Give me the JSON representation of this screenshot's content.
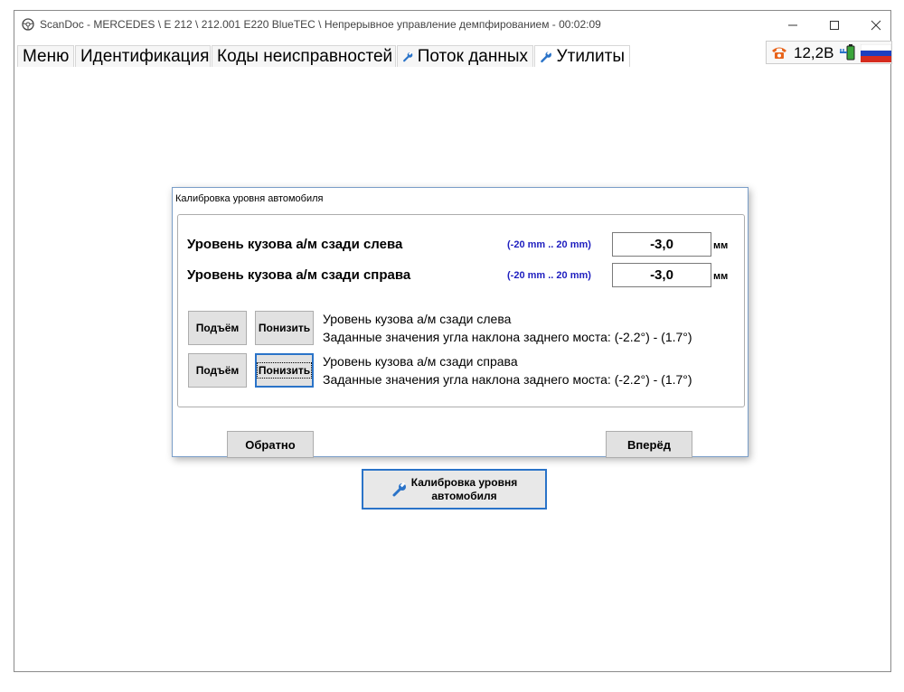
{
  "window": {
    "title": "ScanDoc - MERCEDES \\ E 212 \\ 212.001 E220 BlueTEC \\ Непрерывное управление демпфированием - 00:02:09"
  },
  "tabs": [
    {
      "label": "Меню",
      "icon": ""
    },
    {
      "label": "Идентификация",
      "icon": ""
    },
    {
      "label": "Коды неисправностей",
      "icon": ""
    },
    {
      "label": "Поток данных",
      "icon": "wrench-icon"
    },
    {
      "label": "Утилиты",
      "icon": "wrench-icon"
    }
  ],
  "status": {
    "voltage": "12,2В"
  },
  "dialog": {
    "title": "Калибровка уровня автомобиля",
    "params": [
      {
        "label": "Уровень кузова а/м сзади слева",
        "range": "(-20 mm .. 20 mm)",
        "value": "-3,0",
        "unit": "мм"
      },
      {
        "label": "Уровень кузова а/м сзади справа",
        "range": "(-20 mm .. 20 mm)",
        "value": "-3,0",
        "unit": "мм"
      }
    ],
    "controls": [
      {
        "raise": "Подъём",
        "lower": "Понизить",
        "line1": "Уровень кузова а/м сзади слева",
        "line2": "Заданные значения угла наклона заднего моста: (-2.2°) - (1.7°)"
      },
      {
        "raise": "Подъём",
        "lower": "Понизить",
        "line1": "Уровень кузова а/м сзади справа",
        "line2": "Заданные значения угла наклона заднего моста: (-2.2°) - (1.7°)"
      }
    ],
    "back_label": "Обратно",
    "forward_label": "Вперёд"
  },
  "calibration_button": {
    "line1": "Калибровка уровня",
    "line2": "автомобиля"
  },
  "colors": {
    "accent": "#2a73c8",
    "range_text": "#1e1ebf"
  }
}
